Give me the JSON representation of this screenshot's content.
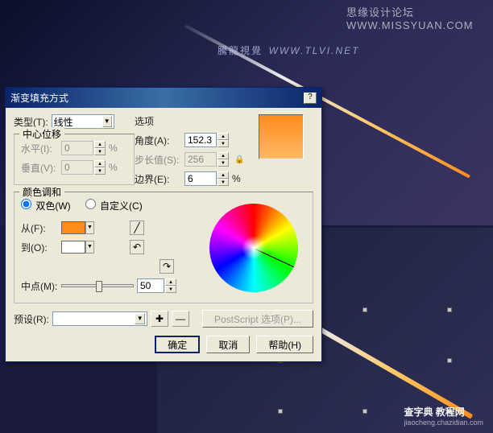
{
  "watermarks": {
    "top": "思缘设计论坛  WWW.MISSYUAN.COM",
    "logo_cn": "騰龍視覺",
    "logo_en": "WWW.TLVI.NET",
    "bottom_main": "查字典 教程网",
    "bottom_sub": "jiaocheng.chazidian.com"
  },
  "dialog": {
    "title": "渐变填充方式",
    "type_label": "类型(T):",
    "type_value": "线性",
    "center_group": "中心位移",
    "horiz_label": "水平(I):",
    "horiz_value": "0",
    "vert_label": "垂直(V):",
    "vert_value": "0",
    "percent": "%",
    "options_group": "选项",
    "angle_label": "角度(A):",
    "angle_value": "152.3",
    "step_label": "步长值(S):",
    "step_value": "256",
    "edge_label": "边界(E):",
    "edge_value": "6",
    "color_section": "颜色调和",
    "twocolor": "双色(W)",
    "custom": "自定义(C)",
    "from_label": "从(F):",
    "to_label": "到(O):",
    "mid_label": "中点(M):",
    "mid_value": "50",
    "preset_label": "预设(R):",
    "postscript": "PostScript 选项(P)...",
    "ok": "确定",
    "cancel": "取消",
    "help": "帮助(H)"
  }
}
